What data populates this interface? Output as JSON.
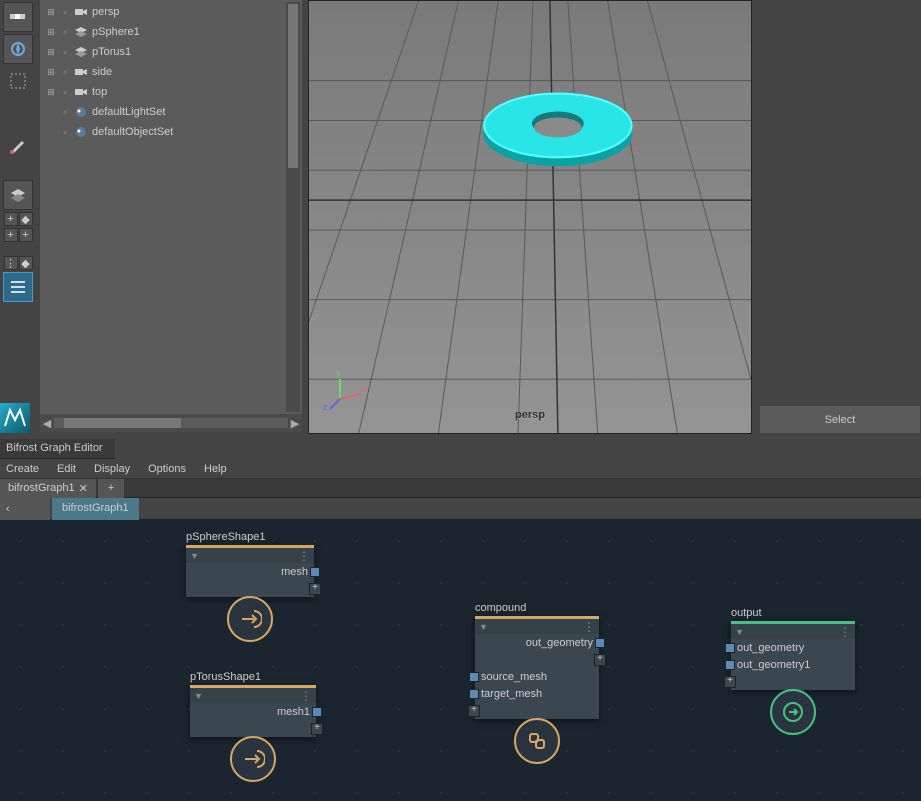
{
  "outliner": {
    "items": [
      {
        "icon": "camera",
        "label": "persp"
      },
      {
        "icon": "layers",
        "label": "pSphere1"
      },
      {
        "icon": "layers",
        "label": "pTorus1"
      },
      {
        "icon": "camera",
        "label": "side"
      },
      {
        "icon": "camera",
        "label": "top"
      },
      {
        "icon": "sphere",
        "label": "defaultLightSet",
        "noExpand": true
      },
      {
        "icon": "sphere",
        "label": "defaultObjectSet",
        "noExpand": true
      }
    ]
  },
  "viewport": {
    "label": "persp",
    "axis": {
      "x": "x",
      "y": "y",
      "z": "z"
    }
  },
  "right": {
    "select_label": "Select"
  },
  "bge": {
    "title": "Bifrost Graph Editor",
    "menu": [
      "Create",
      "Edit",
      "Display",
      "Options",
      "Help"
    ],
    "tab": "bifrostGraph1",
    "tab_add": "+",
    "crumb": "bifrostGraph1",
    "back_glyph": "‹"
  },
  "nodes": {
    "n1": {
      "title": "pSphereShape1",
      "rows": [
        "mesh"
      ]
    },
    "n2": {
      "title": "pTorusShape1",
      "rows": [
        "mesh1"
      ]
    },
    "n3": {
      "title": "compound",
      "out": "out_geometry",
      "ins": [
        "source_mesh",
        "target_mesh"
      ]
    },
    "n4": {
      "title": "output",
      "rows": [
        "out_geometry",
        "out_geometry1"
      ]
    }
  }
}
